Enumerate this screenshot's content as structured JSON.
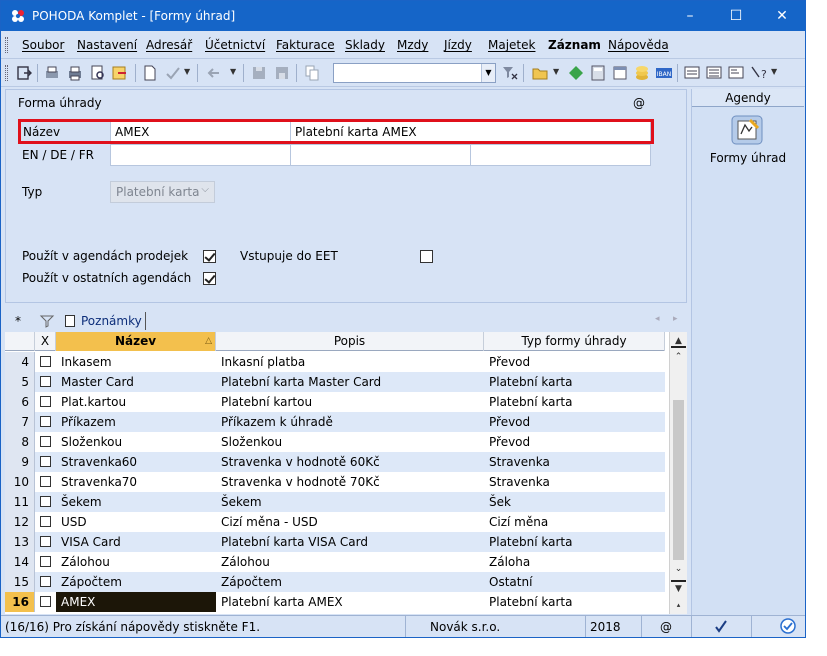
{
  "window": {
    "title": "POHODA Komplet - [Formy úhrad]",
    "controls": {
      "minimize": "–",
      "maximize": "☐",
      "close": "✕"
    }
  },
  "menu": [
    "Soubor",
    "Nastavení",
    "Adresář",
    "Účetnictví",
    "Fakturace",
    "Sklady",
    "Mzdy",
    "Jízdy",
    "Majetek",
    "Záznam",
    "Nápověda"
  ],
  "form": {
    "section_title": "Forma úhrady",
    "at_symbol": "@",
    "nazev_label": "Název",
    "nazev_value": "AMEX",
    "nazev_text": "Platební karta AMEX",
    "lang_label": "EN / DE / FR",
    "typ_label": "Typ",
    "typ_value": "Platební karta",
    "use_sales_label": "Použít v agendách prodejek",
    "use_sales_checked": true,
    "eet_label": "Vstupuje do EET",
    "eet_checked": false,
    "use_other_label": "Použít v ostatních agendách",
    "use_other_checked": true
  },
  "agendy": {
    "header": "Agendy",
    "item_label": "Formy úhrad",
    "icon": "payment-forms-icon"
  },
  "tabs": {
    "star": "*",
    "notes": "Poznámky"
  },
  "grid": {
    "columns": {
      "x": "X",
      "nazev": "Název",
      "popis": "Popis",
      "typ": "Typ formy úhrady"
    },
    "rows": [
      {
        "num": "4",
        "nazev": "Inkasem",
        "popis": "Inkasní platba",
        "typ": "Převod"
      },
      {
        "num": "5",
        "nazev": "Master Card",
        "popis": "Platební karta Master Card",
        "typ": "Platební karta"
      },
      {
        "num": "6",
        "nazev": "Plat.kartou",
        "popis": "Platební kartou",
        "typ": "Platební karta"
      },
      {
        "num": "7",
        "nazev": "Příkazem",
        "popis": "Příkazem k úhradě",
        "typ": "Převod"
      },
      {
        "num": "8",
        "nazev": "Složenkou",
        "popis": "Složenkou",
        "typ": "Převod"
      },
      {
        "num": "9",
        "nazev": "Stravenka60",
        "popis": "Stravenka v hodnotě 60Kč",
        "typ": "Stravenka"
      },
      {
        "num": "10",
        "nazev": "Stravenka70",
        "popis": "Stravenka v hodnotě 70Kč",
        "typ": "Stravenka"
      },
      {
        "num": "11",
        "nazev": "Šekem",
        "popis": "Šekem",
        "typ": "Šek"
      },
      {
        "num": "12",
        "nazev": "USD",
        "popis": "Cizí měna - USD",
        "typ": "Cizí měna"
      },
      {
        "num": "13",
        "nazev": "VISA Card",
        "popis": "Platební karta VISA Card",
        "typ": "Platební karta"
      },
      {
        "num": "14",
        "nazev": "Zálohou",
        "popis": "Zálohou",
        "typ": "Záloha"
      },
      {
        "num": "15",
        "nazev": "Zápočtem",
        "popis": "Zápočtem",
        "typ": "Ostatní"
      },
      {
        "num": "16",
        "nazev": "AMEX",
        "popis": "Platební karta AMEX",
        "typ": "Platební karta"
      }
    ],
    "selected_index": 12
  },
  "status": {
    "hint": "(16/16) Pro získání nápovědy stiskněte F1.",
    "company": "Novák s.r.o.",
    "year": "2018",
    "at": "@"
  },
  "colors": {
    "titlebar": "#1565c8",
    "highlight_border": "#e0101b",
    "sorted_column": "#f3c04d",
    "selected_cell": "#1c1608",
    "alt_row": "#dde8f8"
  }
}
